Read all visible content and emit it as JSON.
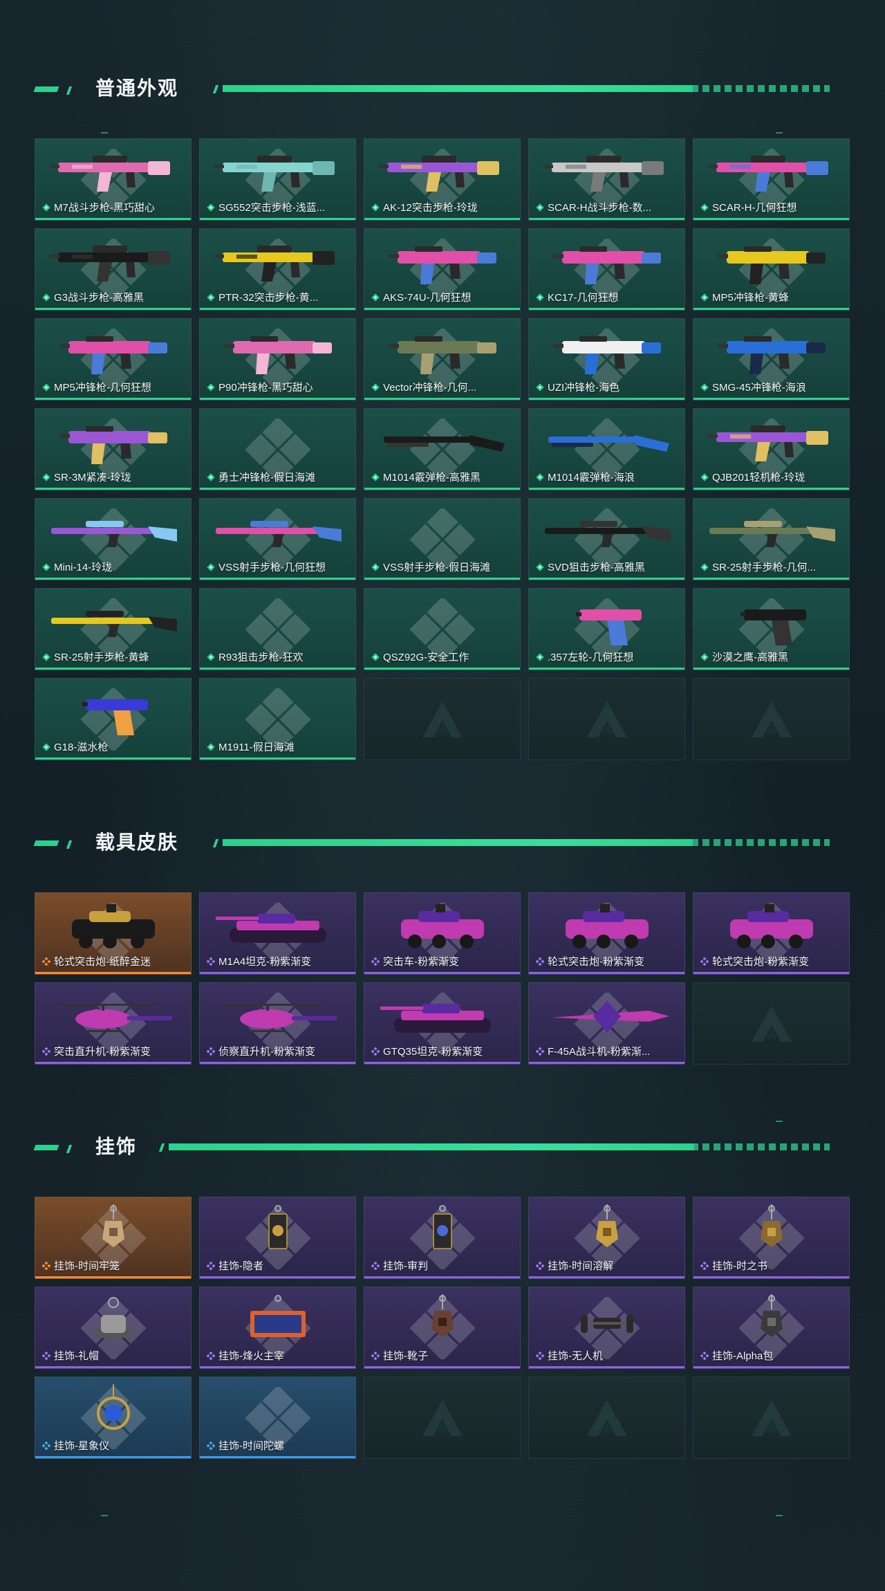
{
  "sections": {
    "weapons": {
      "title": "普通外观",
      "items": [
        {
          "label": "M7战斗步枪-黑巧甜心",
          "rarity": "green",
          "kind": "rifle",
          "c1": "#e06ab0",
          "c2": "#f3b6d6"
        },
        {
          "label": "SG552突击步枪-浅蓝...",
          "rarity": "green",
          "kind": "rifle",
          "c1": "#86d4cf",
          "c2": "#6fb8b2"
        },
        {
          "label": "AK-12突击步枪-玲珑",
          "rarity": "green",
          "kind": "rifle",
          "c1": "#9b56d6",
          "c2": "#e0c060"
        },
        {
          "label": "SCAR-H战斗步枪-数...",
          "rarity": "green",
          "kind": "rifle",
          "c1": "#c8c8c8",
          "c2": "#7a7a7a"
        },
        {
          "label": "SCAR-H-几何狂想",
          "rarity": "green",
          "kind": "rifle",
          "c1": "#e24fa8",
          "c2": "#4b7bd8"
        },
        {
          "label": "G3战斗步枪-高雅黑",
          "rarity": "green",
          "kind": "rifle",
          "c1": "#1a1a1a",
          "c2": "#333333"
        },
        {
          "label": "PTR-32突击步枪-黄...",
          "rarity": "green",
          "kind": "rifle",
          "c1": "#e6c81e",
          "c2": "#222222"
        },
        {
          "label": "AKS-74U-几何狂想",
          "rarity": "green",
          "kind": "smg",
          "c1": "#e24fa8",
          "c2": "#4b7bd8"
        },
        {
          "label": "KC17-几何狂想",
          "rarity": "green",
          "kind": "smg",
          "c1": "#e24fa8",
          "c2": "#4b7bd8"
        },
        {
          "label": "MP5冲锋枪-黄蜂",
          "rarity": "green",
          "kind": "smg",
          "c1": "#e6c81e",
          "c2": "#222222"
        },
        {
          "label": "MP5冲锋枪-几何狂想",
          "rarity": "green",
          "kind": "smg",
          "c1": "#e24fa8",
          "c2": "#4b7bd8"
        },
        {
          "label": "P90冲锋枪-黑巧甜心",
          "rarity": "green",
          "kind": "smg",
          "c1": "#e06ab0",
          "c2": "#f3b6d6"
        },
        {
          "label": "Vector冲锋枪-几何...",
          "rarity": "green",
          "kind": "smg",
          "c1": "#6c7a54",
          "c2": "#a8a070"
        },
        {
          "label": "UZI冲锋枪-海色",
          "rarity": "green",
          "kind": "smg",
          "c1": "#f0f0f0",
          "c2": "#2a6ed8"
        },
        {
          "label": "SMG-45冲锋枪-海浪",
          "rarity": "green",
          "kind": "smg",
          "c1": "#2a6ed8",
          "c2": "#1a2a4a"
        },
        {
          "label": "SR-3M紧凑-玲珑",
          "rarity": "green",
          "kind": "smg",
          "c1": "#9b56d6",
          "c2": "#e0c060"
        },
        {
          "label": "勇士冲锋枪-假日海滩",
          "rarity": "green",
          "kind": "none",
          "c1": "#000000",
          "c2": "#000000"
        },
        {
          "label": "M1014霰弹枪-高雅黑",
          "rarity": "green",
          "kind": "shotgun",
          "c1": "#1a1a1a",
          "c2": "#333333"
        },
        {
          "label": "M1014霰弹枪-海浪",
          "rarity": "green",
          "kind": "shotgun",
          "c1": "#2a6ed8",
          "c2": "#1a2a4a"
        },
        {
          "label": "QJB201轻机枪-玲珑",
          "rarity": "green",
          "kind": "rifle",
          "c1": "#9b56d6",
          "c2": "#e0c060"
        },
        {
          "label": "Mini-14-玲珑",
          "rarity": "green",
          "kind": "sniper",
          "c1": "#9b56d6",
          "c2": "#86c8f0"
        },
        {
          "label": "VSS射手步枪-几何狂想",
          "rarity": "green",
          "kind": "sniper",
          "c1": "#e24fa8",
          "c2": "#4b7bd8"
        },
        {
          "label": "VSS射手步枪-假日海滩",
          "rarity": "green",
          "kind": "none",
          "c1": "#000000",
          "c2": "#000000"
        },
        {
          "label": "SVD狙击步枪-高雅黑",
          "rarity": "green",
          "kind": "sniper",
          "c1": "#1a1a1a",
          "c2": "#333333"
        },
        {
          "label": "SR-25射手步枪-几何...",
          "rarity": "green",
          "kind": "sniper",
          "c1": "#6c7a54",
          "c2": "#a8a070"
        },
        {
          "label": "SR-25射手步枪-黄蜂",
          "rarity": "green",
          "kind": "sniper",
          "c1": "#e6c81e",
          "c2": "#222222"
        },
        {
          "label": "R93狙击步枪-狂欢",
          "rarity": "green",
          "kind": "none",
          "c1": "#000000",
          "c2": "#000000"
        },
        {
          "label": "QSZ92G-安全工作",
          "rarity": "green",
          "kind": "none",
          "c1": "#000000",
          "c2": "#000000"
        },
        {
          "label": ".357左轮-几何狂想",
          "rarity": "green",
          "kind": "pistol",
          "c1": "#e24fa8",
          "c2": "#4b7bd8"
        },
        {
          "label": "沙漠之鹰-高雅黑",
          "rarity": "green",
          "kind": "pistol",
          "c1": "#1a1a1a",
          "c2": "#333333"
        },
        {
          "label": "G18-滋水枪",
          "rarity": "green",
          "kind": "pistol",
          "c1": "#3a3ad8",
          "c2": "#f0a040"
        },
        {
          "label": "M1911-假日海滩",
          "rarity": "green",
          "kind": "none",
          "c1": "#000000",
          "c2": "#000000"
        },
        {
          "label": "",
          "rarity": "empty",
          "kind": "empty",
          "c1": "",
          "c2": ""
        },
        {
          "label": "",
          "rarity": "empty",
          "kind": "empty",
          "c1": "",
          "c2": ""
        },
        {
          "label": "",
          "rarity": "empty",
          "kind": "empty",
          "c1": "",
          "c2": ""
        }
      ]
    },
    "vehicles": {
      "title": "载具皮肤",
      "items": [
        {
          "label": "轮式突击炮-纸醉金迷",
          "rarity": "orange",
          "kind": "car",
          "c1": "#1a1a1a",
          "c2": "#c8a040"
        },
        {
          "label": "M1A4坦克-粉紫渐变",
          "rarity": "purple",
          "kind": "tank",
          "c1": "#c03ab0",
          "c2": "#5a2aa0"
        },
        {
          "label": "突击车-粉紫渐变",
          "rarity": "purple",
          "kind": "car",
          "c1": "#c03ab0",
          "c2": "#5a2aa0"
        },
        {
          "label": "轮式突击炮-粉紫渐变",
          "rarity": "purple",
          "kind": "car",
          "c1": "#c03ab0",
          "c2": "#5a2aa0"
        },
        {
          "label": "轮式突击炮-粉紫渐变",
          "rarity": "purple",
          "kind": "car",
          "c1": "#c03ab0",
          "c2": "#5a2aa0"
        },
        {
          "label": "突击直升机-粉紫渐变",
          "rarity": "purple",
          "kind": "heli",
          "c1": "#c03ab0",
          "c2": "#5a2aa0"
        },
        {
          "label": "侦察直升机-粉紫渐变",
          "rarity": "purple",
          "kind": "heli",
          "c1": "#c03ab0",
          "c2": "#5a2aa0"
        },
        {
          "label": "GTQ35坦克-粉紫渐变",
          "rarity": "purple",
          "kind": "tank",
          "c1": "#c03ab0",
          "c2": "#5a2aa0"
        },
        {
          "label": "F-45A战斗机-粉紫渐...",
          "rarity": "purple",
          "kind": "jet",
          "c1": "#c03ab0",
          "c2": "#5a2aa0"
        },
        {
          "label": "",
          "rarity": "empty",
          "kind": "empty",
          "c1": "",
          "c2": ""
        }
      ]
    },
    "charms": {
      "title": "挂饰",
      "items": [
        {
          "label": "挂饰-时间牢笼",
          "rarity": "orange",
          "kind": "charm",
          "c1": "#c8a878",
          "c2": "#7a5a40"
        },
        {
          "label": "挂饰-隐者",
          "rarity": "purple",
          "kind": "card",
          "c1": "#2a2a2a",
          "c2": "#c8a040"
        },
        {
          "label": "挂饰-审判",
          "rarity": "purple",
          "kind": "card",
          "c1": "#2a2a2a",
          "c2": "#4a6ad8"
        },
        {
          "label": "挂饰-时间溶解",
          "rarity": "purple",
          "kind": "charm",
          "c1": "#c8a040",
          "c2": "#7a5a20"
        },
        {
          "label": "挂饰-时之书",
          "rarity": "purple",
          "kind": "charm",
          "c1": "#8a6a30",
          "c2": "#c8a040"
        },
        {
          "label": "挂饰-礼帽",
          "rarity": "purple",
          "kind": "hat",
          "c1": "#9a9a9a",
          "c2": "#555555"
        },
        {
          "label": "挂饰-烽火主宰",
          "rarity": "purple",
          "kind": "banner",
          "c1": "#e0602a",
          "c2": "#2a3a8a"
        },
        {
          "label": "挂饰-靴子",
          "rarity": "purple",
          "kind": "charm",
          "c1": "#6a4030",
          "c2": "#3a2018"
        },
        {
          "label": "挂饰-无人机",
          "rarity": "purple",
          "kind": "drone",
          "c1": "#2a2a2a",
          "c2": "#555555"
        },
        {
          "label": "挂饰-Alpha包",
          "rarity": "purple",
          "kind": "charm",
          "c1": "#3a3a3a",
          "c2": "#6a6a6a"
        },
        {
          "label": "挂饰-星象仪",
          "rarity": "blue",
          "kind": "orb",
          "c1": "#c8a040",
          "c2": "#2a5ad8"
        },
        {
          "label": "挂饰-时间陀螺",
          "rarity": "blue",
          "kind": "none",
          "c1": "#000000",
          "c2": "#000000"
        },
        {
          "label": "",
          "rarity": "empty",
          "kind": "empty",
          "c1": "",
          "c2": ""
        },
        {
          "label": "",
          "rarity": "empty",
          "kind": "empty",
          "c1": "",
          "c2": ""
        },
        {
          "label": "",
          "rarity": "empty",
          "kind": "empty",
          "c1": "",
          "c2": ""
        }
      ]
    }
  },
  "colors": {
    "accent_green": "#2bd28c",
    "purple_rarity": "#8b62e6",
    "orange_rarity": "#ff8a2a",
    "blue_rarity": "#3d9ce8"
  }
}
